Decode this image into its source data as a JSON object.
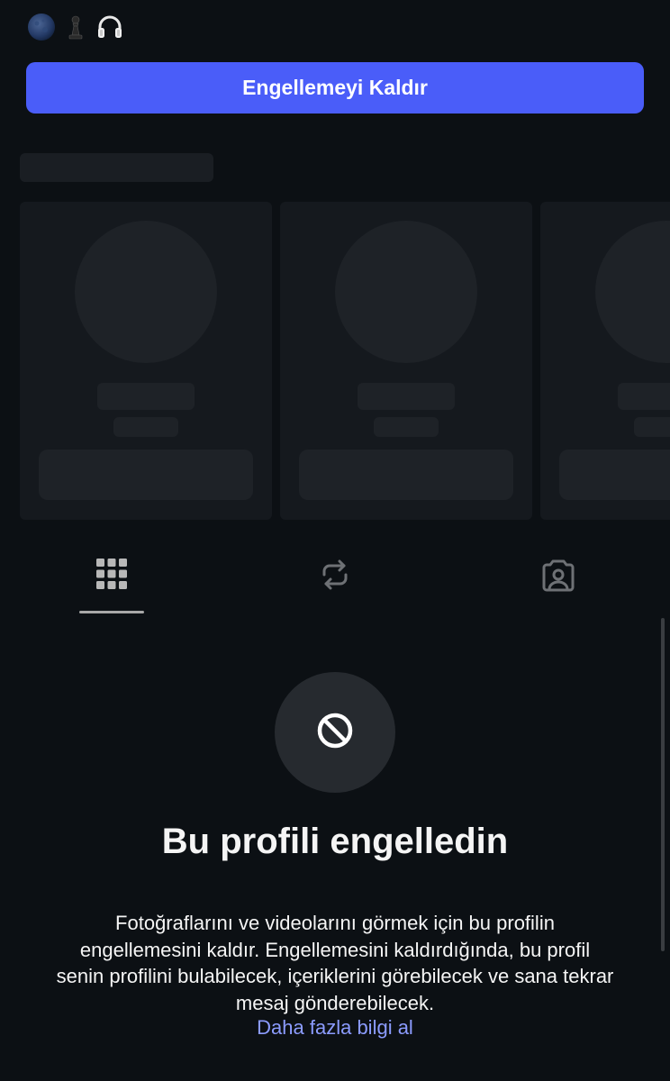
{
  "top_emojis": [
    "blue-moon-icon",
    "chess-pawn-icon",
    "headphones-icon"
  ],
  "unblock_button": {
    "label": "Engellemeyi Kaldır"
  },
  "colors": {
    "background": "#0c1014",
    "accent": "#4a5df9",
    "link": "#8c9cff",
    "skeleton": "#1a1e23"
  },
  "tabs": [
    {
      "name": "posts-grid",
      "icon": "grid-icon",
      "active": true
    },
    {
      "name": "reposts",
      "icon": "repost-icon",
      "active": false
    },
    {
      "name": "tagged",
      "icon": "tagged-person-icon",
      "active": false
    }
  ],
  "blocked": {
    "icon": "block-icon",
    "title": "Bu profili engelledin",
    "description": "Fotoğraflarını ve videolarını görmek için bu profilin engellemesini kaldır. Engellemesini kaldırdığında, bu profil senin profilini bulabilecek, içeriklerini görebilecek ve sana tekrar mesaj gönderebilecek.",
    "learn_more": "Daha fazla bilgi al"
  }
}
